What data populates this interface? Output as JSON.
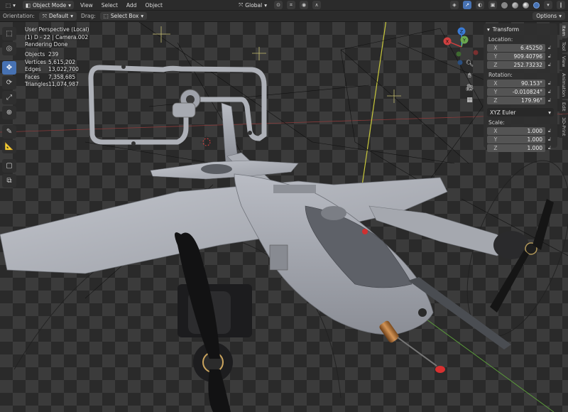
{
  "header": {
    "editor_type_icon": "viewport-icon",
    "mode": "Object Mode",
    "menus": [
      "View",
      "Select",
      "Add",
      "Object"
    ],
    "transform_orientation": "Global",
    "colors": {
      "header_bg": "#2b2b2b",
      "active_blue": "#4772b3"
    }
  },
  "tool_settings": {
    "orientation_label": "Orientation:",
    "orientation_value": "Default",
    "drag_label": "Drag:",
    "drag_value": "Select Box",
    "options_label": "Options"
  },
  "overlay": {
    "view_name": "User Perspective (Local)",
    "object_line": "(1) D - 22 | Camera.002",
    "render_status": "Rendering Done",
    "stats": [
      {
        "label": "Objects",
        "value": "239"
      },
      {
        "label": "Vertices",
        "value": "5,615,202"
      },
      {
        "label": "Edges",
        "value": "13,022,700"
      },
      {
        "label": "Faces",
        "value": "7,358,685"
      },
      {
        "label": "Triangles",
        "value": "11,074,987"
      }
    ]
  },
  "gizmo": {
    "x": "X",
    "y": "Y",
    "z": "Z"
  },
  "left_tools": [
    "select-box-icon",
    "cursor-icon",
    "move-icon",
    "rotate-icon",
    "scale-icon",
    "transform-icon",
    "annotate-icon",
    "measure-icon",
    "add-cube-icon",
    "camera-box-icon"
  ],
  "npanel": {
    "title": "Transform",
    "location_label": "Location:",
    "location": [
      {
        "axis": "X",
        "value": "6.45250"
      },
      {
        "axis": "Y",
        "value": "909.40796"
      },
      {
        "axis": "Z",
        "value": "252.73232"
      }
    ],
    "rotation_label": "Rotation:",
    "rotation": [
      {
        "axis": "X",
        "value": "90.153°"
      },
      {
        "axis": "Y",
        "value": "-0.010824°"
      },
      {
        "axis": "Z",
        "value": "179.96°"
      }
    ],
    "rotation_mode": "XYZ Euler",
    "scale_label": "Scale:",
    "scale": [
      {
        "axis": "X",
        "value": "1.000"
      },
      {
        "axis": "Y",
        "value": "1.000"
      },
      {
        "axis": "Z",
        "value": "1.000"
      }
    ]
  },
  "side_tabs": [
    "Item",
    "Tool",
    "View",
    "Animation",
    "Edit",
    "3D-Print"
  ]
}
